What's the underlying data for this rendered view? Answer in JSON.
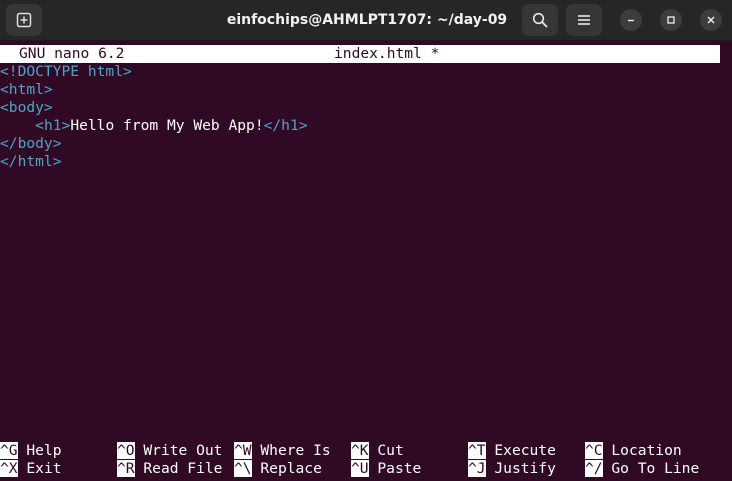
{
  "window": {
    "title": "einfochips@AHMLPT1707: ~/day-09"
  },
  "nano": {
    "version_label": "GNU nano 6.2",
    "filename": "index.html *"
  },
  "editor_lines": [
    {
      "indent": "",
      "tag_open": "<!DOCTYPE html>",
      "text": "",
      "tag_close": ""
    },
    {
      "indent": "",
      "tag_open": "<html>",
      "text": "",
      "tag_close": ""
    },
    {
      "indent": "",
      "tag_open": "<body>",
      "text": "",
      "tag_close": ""
    },
    {
      "indent": "    ",
      "tag_open": "<h1>",
      "text": "Hello from My Web App!",
      "tag_close": "</h1>"
    },
    {
      "indent": "",
      "tag_open": "</body>",
      "text": "",
      "tag_close": ""
    },
    {
      "indent": "",
      "tag_open": "</html>",
      "text": "",
      "tag_close": ""
    }
  ],
  "shortcuts": {
    "row1": [
      {
        "key": "^G",
        "label": "Help"
      },
      {
        "key": "^O",
        "label": "Write Out"
      },
      {
        "key": "^W",
        "label": "Where Is"
      },
      {
        "key": "^K",
        "label": "Cut"
      },
      {
        "key": "^T",
        "label": "Execute"
      },
      {
        "key": "^C",
        "label": "Location"
      }
    ],
    "row2": [
      {
        "key": "^X",
        "label": "Exit"
      },
      {
        "key": "^R",
        "label": "Read File"
      },
      {
        "key": "^\\",
        "label": "Replace"
      },
      {
        "key": "^U",
        "label": "Paste"
      },
      {
        "key": "^J",
        "label": "Justify"
      },
      {
        "key": "^/",
        "label": "Go To Line"
      }
    ]
  },
  "colors": {
    "background": "#300a24",
    "tag": "#4fa3c7",
    "text": "#ffffff"
  },
  "icons": [
    "new-tab-icon",
    "search-icon",
    "hamburger-menu-icon",
    "minimize-icon",
    "maximize-icon",
    "close-icon"
  ]
}
